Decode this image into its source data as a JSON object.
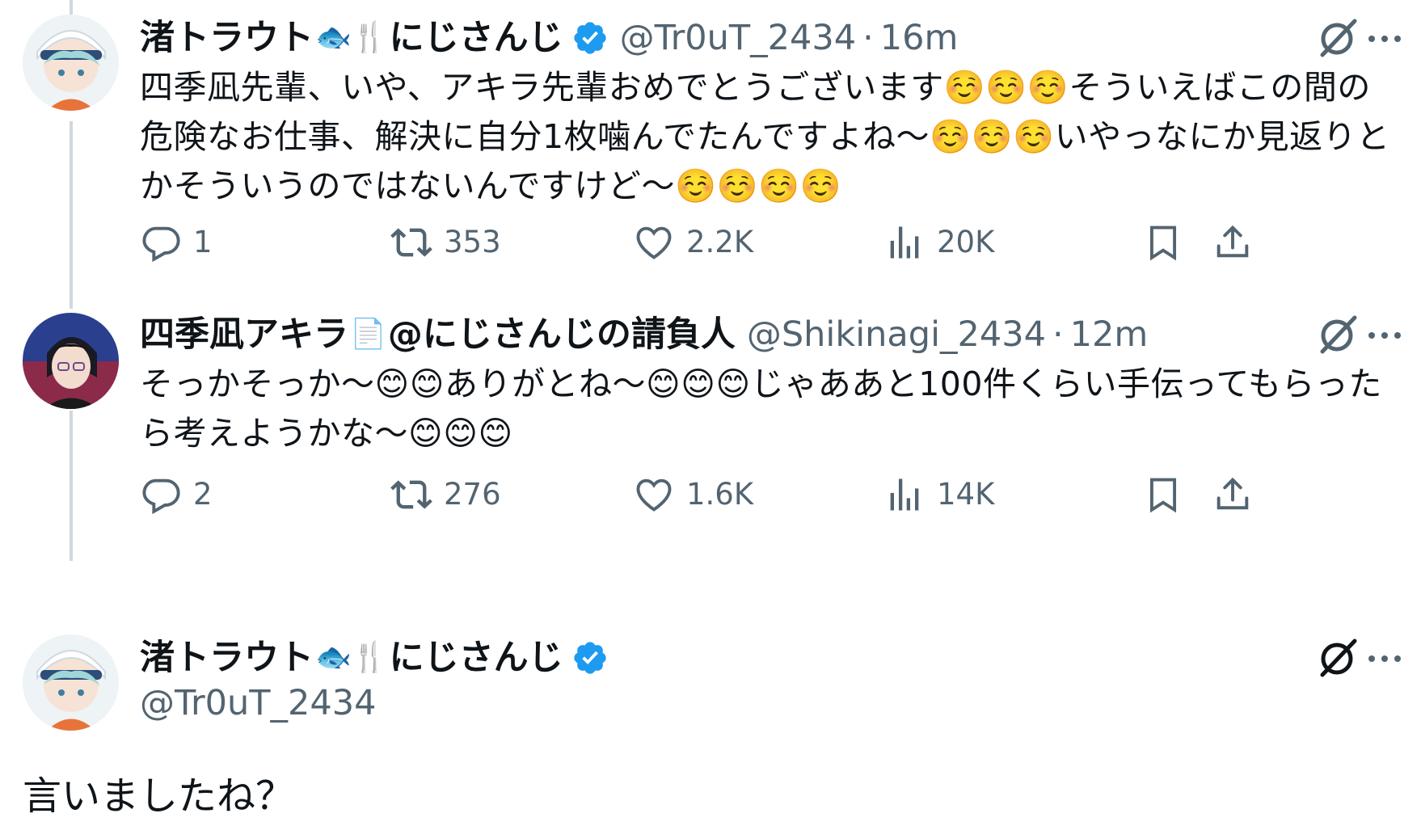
{
  "tweets": [
    {
      "display_name": "渚トラウト",
      "name_emoji": "🐟🍴",
      "name_suffix": "にじさんじ",
      "handle": "@Tr0uT_2434",
      "separator": "·",
      "time": "16m",
      "verified": true,
      "text": "四季凪先輩、いや、アキラ先輩おめでとうございます☺️☺️☺️そういえばこの間の危険なお仕事、解決に自分1枚噛んでたんですよね〜☺️☺️☺️いやっなにか見返りとかそういうのではないんですけど〜☺️☺️☺️☺️",
      "replies": "1",
      "retweets": "353",
      "likes": "2.2K",
      "views": "20K"
    },
    {
      "display_name": "四季凪アキラ",
      "name_emoji": "📄",
      "name_suffix": "@にじさんじの請負人",
      "handle": "@Shikinagi_2434",
      "separator": "·",
      "time": "12m",
      "verified": false,
      "text": "そっかそっか〜😊😊ありがとね〜😊😊😊じゃああと100件くらい手伝ってもらったら考えようかな〜😊😊😊",
      "replies": "2",
      "retweets": "276",
      "likes": "1.6K",
      "views": "14K"
    }
  ],
  "main_tweet": {
    "display_name": "渚トラウト",
    "name_emoji": "🐟🍴",
    "name_suffix": "にじさんじ",
    "handle": "@Tr0uT_2434",
    "verified": true,
    "text": "言いましたね？"
  },
  "icons": {
    "reply": "reply-icon",
    "retweet": "retweet-icon",
    "like": "heart-icon",
    "views": "views-icon",
    "bookmark": "bookmark-icon",
    "share": "share-icon",
    "grok": "grok-icon",
    "more": "more-icon",
    "verified": "verified-badge-icon"
  },
  "colors": {
    "text": "#0f1419",
    "secondary": "#536471",
    "verified": "#1d9bf0",
    "thread_line": "#cfd9de"
  }
}
